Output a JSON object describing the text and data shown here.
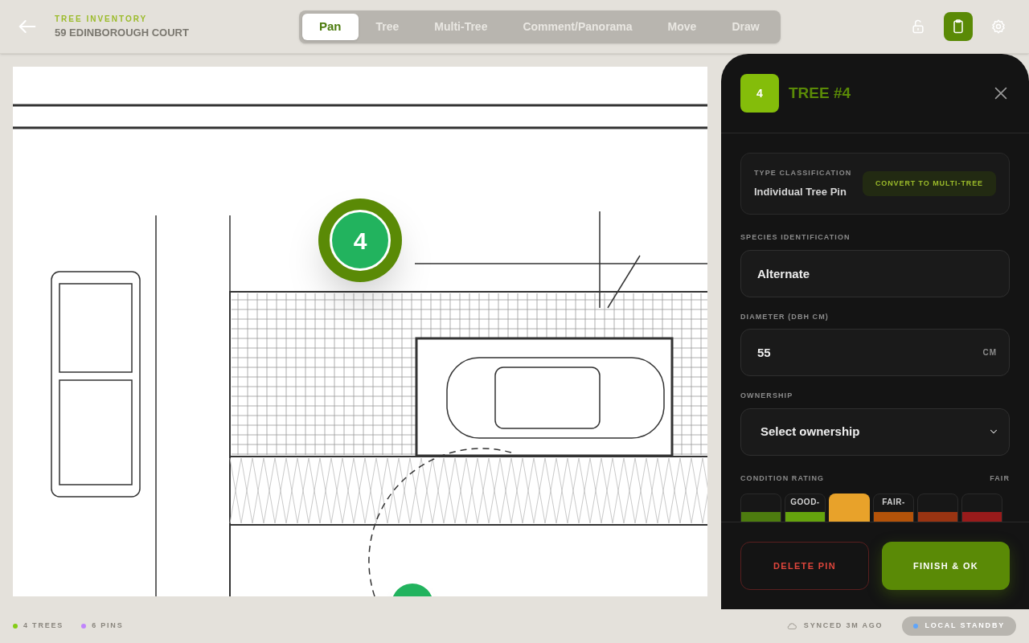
{
  "header": {
    "eyebrow": "TREE INVENTORY",
    "title": "59 EDINBOROUGH COURT"
  },
  "tools": [
    {
      "label": "Pan",
      "selected": true
    },
    {
      "label": "Tree",
      "selected": false
    },
    {
      "label": "Multi-Tree",
      "selected": false
    },
    {
      "label": "Comment/Panorama",
      "selected": false
    },
    {
      "label": "Move",
      "selected": false
    },
    {
      "label": "Draw",
      "selected": false
    }
  ],
  "header_actions": [
    {
      "kind": "lock",
      "selected": false
    },
    {
      "kind": "clipboard",
      "selected": true
    },
    {
      "kind": "settings",
      "selected": false
    }
  ],
  "map": {
    "pins": [
      {
        "label": "4",
        "selected": true
      },
      {
        "selected": false
      }
    ]
  },
  "panel": {
    "badge": "4",
    "title": "TREE #4",
    "type": {
      "label": "TYPE CLASSIFICATION",
      "value": "Individual Tree Pin",
      "action": "CONVERT TO MULTI-TREE"
    },
    "species": {
      "label": "SPECIES IDENTIFICATION",
      "value": "Alternate"
    },
    "diameter": {
      "label": "DIAMETER (DBH CM)",
      "value": "55",
      "unit": "CM"
    },
    "ownership": {
      "label": "OWNERSHIP",
      "placeholder": "Select ownership"
    },
    "condition": {
      "label": "CONDITION RATING",
      "reading": "FAIR",
      "options": [
        {
          "color": "#4d7c0f",
          "selected": false
        },
        {
          "label": "GOOD-",
          "color": "#65a30d",
          "selected": false
        },
        {
          "color": "#e8a22a",
          "selected": true
        },
        {
          "label": "FAIR-",
          "color": "#b45309",
          "selected": false
        },
        {
          "color": "#9a3412",
          "selected": false
        },
        {
          "color": "#991b1b",
          "selected": false
        }
      ]
    },
    "buttons": [
      {
        "kind": "danger",
        "label": "DELETE PIN"
      },
      {
        "kind": "primary",
        "label": "FINISH & OK"
      }
    ]
  },
  "status_bar": {
    "counts": [
      {
        "label": "4 TREES",
        "color": "#84cc16"
      },
      {
        "label": "6 PINS",
        "color": "#c084fc"
      }
    ],
    "sync": "SYNCED 3M AGO",
    "mode": {
      "label": "LOCAL STANDBY",
      "color": "#60a5fa"
    }
  }
}
